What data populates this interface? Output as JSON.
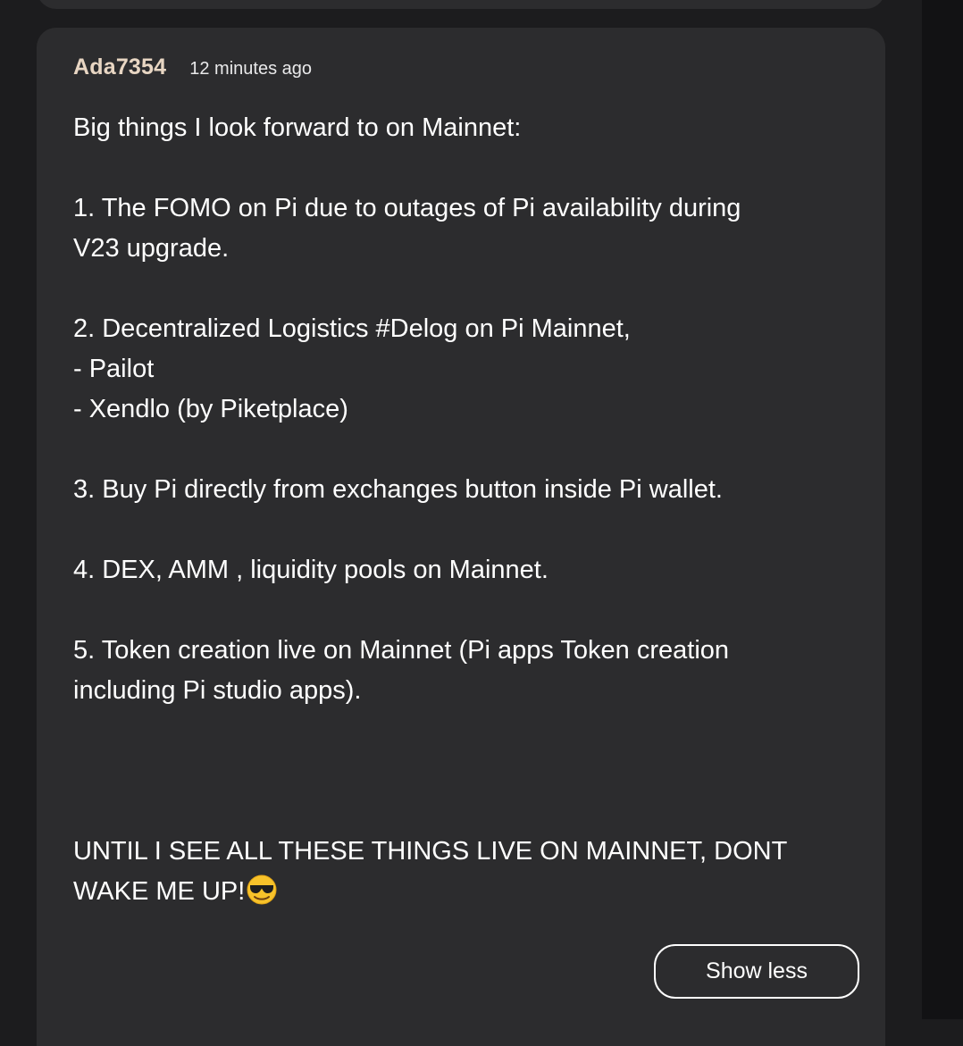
{
  "post": {
    "author": "Ada7354",
    "timestamp": "12 minutes ago",
    "lines": {
      "intro": "Big things I look forward to on Mainnet:",
      "item1_a": "1. The FOMO on Pi due to outages of Pi availability during",
      "item1_b": "V23 upgrade.",
      "item2_a": "2. Decentralized Logistics #Delog on Pi Mainnet,",
      "item2_b": "- Pailot",
      "item2_c": "- Xendlo (by Piketplace)",
      "item3": "3. Buy Pi directly from exchanges button inside Pi wallet.",
      "item4": "4. DEX, AMM , liquidity pools on Mainnet.",
      "item5_a": "5. Token creation live on Mainnet (Pi apps Token creation",
      "item5_b": "including Pi studio apps).",
      "closing_a": "UNTIL I SEE ALL THESE THINGS LIVE ON MAINNET, DONT",
      "closing_b": "WAKE ME UP!"
    },
    "emoji": "smiling-face-with-sunglasses",
    "show_less_label": "Show less"
  },
  "colors": {
    "background": "#1c1c1e",
    "card": "#2c2c2e",
    "username": "#e8d6c3",
    "text": "#ffffff"
  }
}
